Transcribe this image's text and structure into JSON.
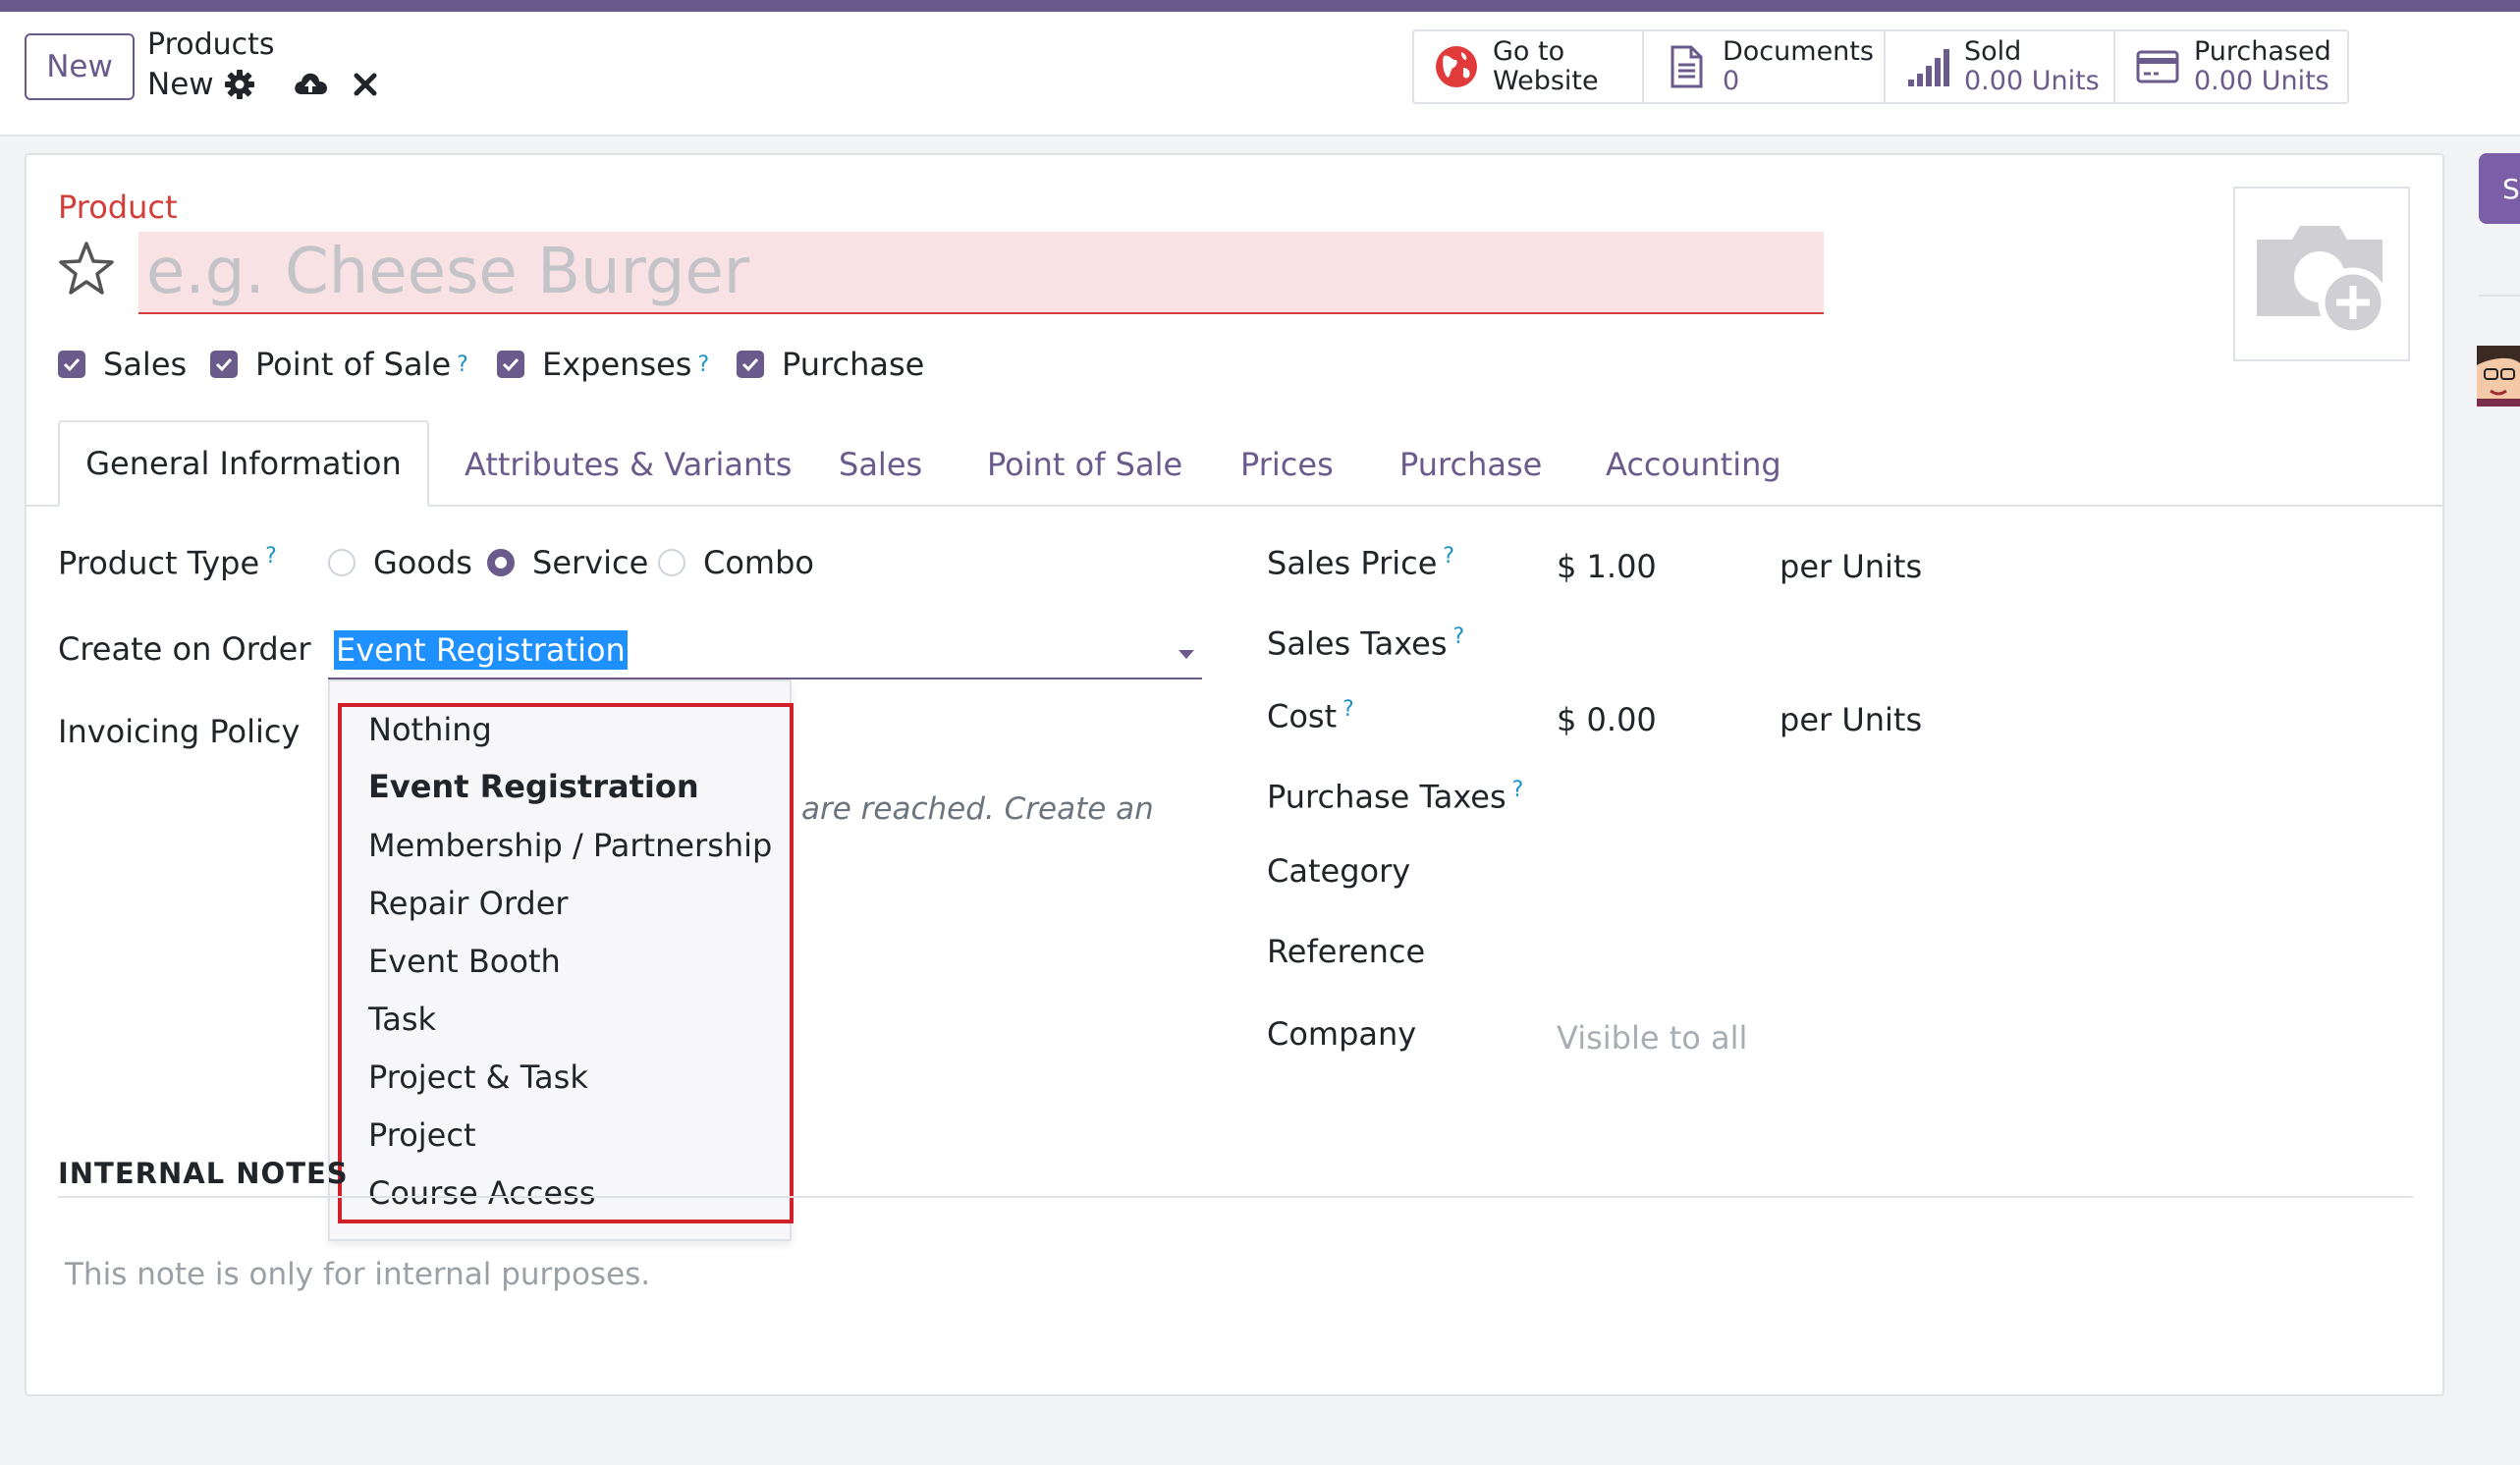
{
  "control_panel": {
    "new_button": "New",
    "breadcrumb_parent": "Products",
    "breadcrumb_current": "New"
  },
  "smart_buttons": [
    {
      "line1": "Go to",
      "line2": "Website",
      "icon": "globe-icon"
    },
    {
      "line1": "Documents",
      "line2": "0",
      "icon": "document-icon"
    },
    {
      "line1": "Sold",
      "line2": "0.00 Units",
      "icon": "bar-chart-icon"
    },
    {
      "line1": "Purchased",
      "line2": "0.00 Units",
      "icon": "credit-card-icon"
    }
  ],
  "side": {
    "tab_letter": "S"
  },
  "form": {
    "product_label": "Product",
    "name_placeholder": "e.g. Cheese Burger",
    "checkboxes": [
      "Sales",
      "Point of Sale",
      "Expenses",
      "Purchase"
    ],
    "help_mark": "?",
    "tabs": [
      "General Information",
      "Attributes & Variants",
      "Sales",
      "Point of Sale",
      "Prices",
      "Purchase",
      "Accounting"
    ],
    "product_type_label": "Product Type",
    "product_type_options": [
      "Goods",
      "Service",
      "Combo"
    ],
    "product_type_selected": "Service",
    "create_on_order_label": "Create on Order",
    "create_on_order_value": "Event Registration",
    "invoicing_policy_label": "Invoicing Policy",
    "behind_text": "are reached. Create an",
    "dropdown_options": [
      "Nothing",
      "Event Registration",
      "Membership / Partnership",
      "Repair Order",
      "Event Booth",
      "Task",
      "Project & Task",
      "Project",
      "Course Access"
    ],
    "internal_notes_heading": "INTERNAL NOTES",
    "internal_notes_placeholder": "This note is only for internal purposes.",
    "right": {
      "sales_price_label": "Sales Price",
      "sales_price_value": "$ 1.00",
      "per_units_1": "per  Units",
      "sales_taxes_label": "Sales Taxes",
      "cost_label": "Cost",
      "cost_value": "$ 0.00",
      "per_units_2": "per  Units",
      "purchase_taxes_label": "Purchase Taxes",
      "category_label": "Category",
      "reference_label": "Reference",
      "company_label": "Company",
      "company_placeholder": "Visible to all"
    }
  },
  "colors": {
    "accent": "#6b5a8c",
    "required": "#d23f3a",
    "highlight_box": "#d0202a",
    "selection": "#1e90ff",
    "help": "#1a93c8"
  }
}
